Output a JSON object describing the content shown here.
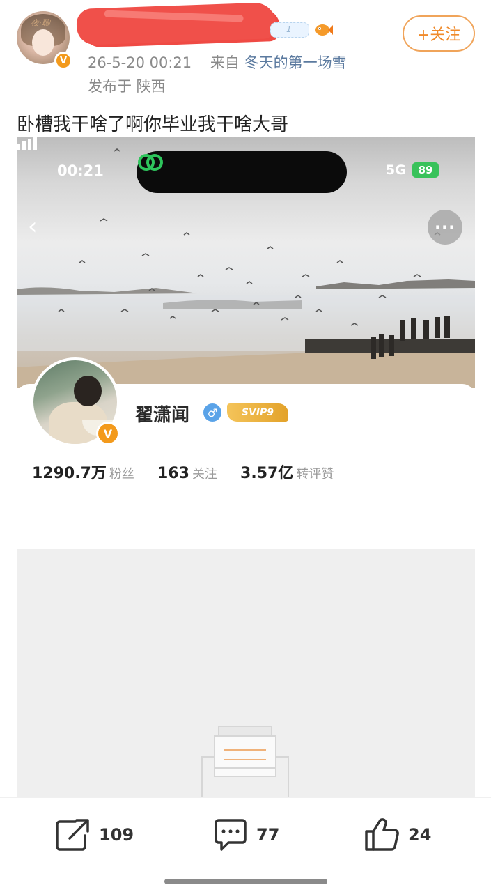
{
  "post": {
    "avatar_deco": "夜·聊",
    "name_tag": "1",
    "time": "26-5-20 00:21",
    "from_label": "来自",
    "source": "冬天的第一场雪",
    "location": "发布于 陕西",
    "follow_label": "+关注",
    "text": "卧槽我干啥了啊你毕业我干啥大哥"
  },
  "screenshot": {
    "status_time": "00:21",
    "network": "5G",
    "battery": "89",
    "back_glyph": "‹",
    "more_glyph": "···",
    "profile": {
      "name": "翟潇闻",
      "gender_glyph": "♂",
      "svip_label": "SVIP9",
      "verified_glyph": "V"
    },
    "stats": [
      {
        "num": "1290.7万",
        "label": "粉丝"
      },
      {
        "num": "163",
        "label": "关注"
      },
      {
        "num": "3.57亿",
        "label": "转评赞"
      }
    ]
  },
  "actions": {
    "repost_count": "109",
    "comment_count": "77",
    "like_count": "24"
  },
  "colors": {
    "accent_orange": "#f08a2a",
    "verified_badge": "#f39a1c",
    "source_link": "#5b7a9f"
  },
  "icons": [
    "fish-icon",
    "link-icon",
    "signal-icon",
    "repost-icon",
    "comment-icon",
    "like-icon",
    "empty-inbox-icon"
  ]
}
